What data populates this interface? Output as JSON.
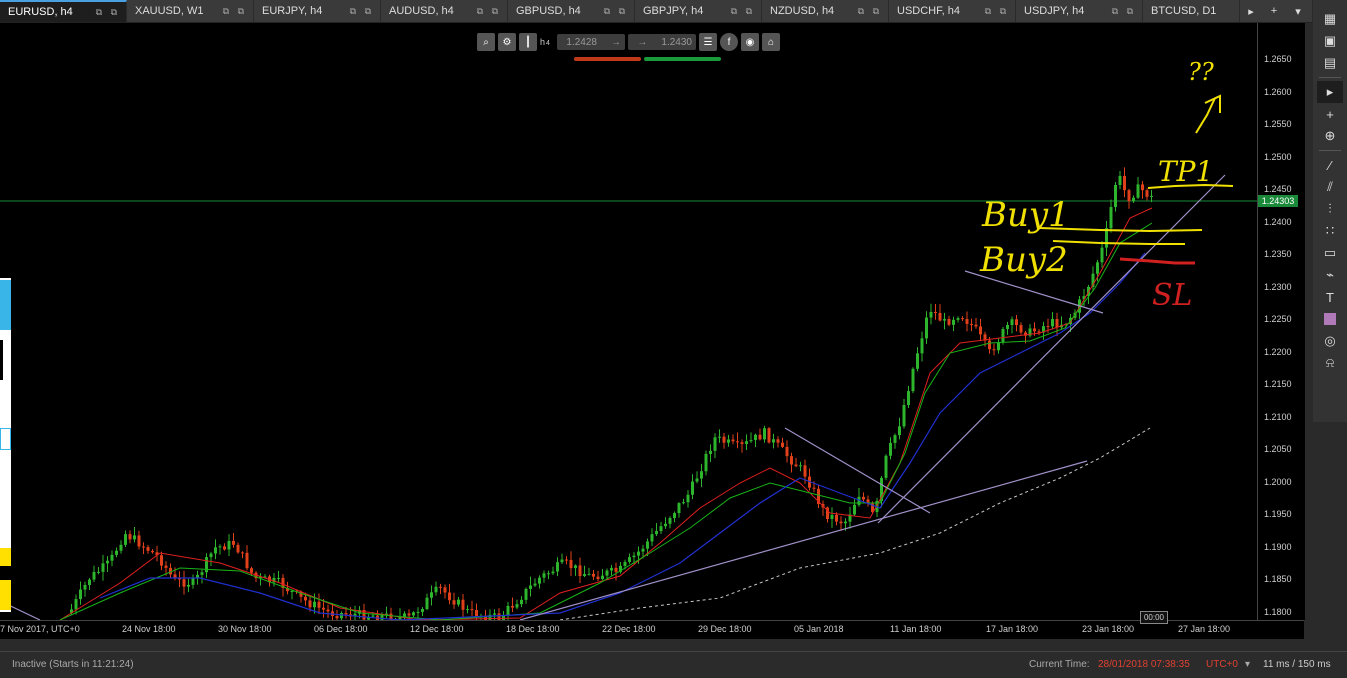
{
  "tabs": [
    {
      "label": "EURUSD, h4",
      "active": true
    },
    {
      "label": "XAUUSD, W1"
    },
    {
      "label": "EURJPY, h4"
    },
    {
      "label": "AUDUSD, h4"
    },
    {
      "label": "GBPUSD, h4"
    },
    {
      "label": "GBPJPY, h4"
    },
    {
      "label": "NZDUSD, h4"
    },
    {
      "label": "USDCHF, h4"
    },
    {
      "label": "USDJPY, h4"
    },
    {
      "label": "BTCUSD, D1"
    }
  ],
  "tab_nav": {
    "next": "▸",
    "add": "+",
    "overflow": "▾"
  },
  "trade_toolbar": {
    "timeframe": "h",
    "lot": "4",
    "sell_price": "1.2428",
    "buy_price": "1.2430"
  },
  "price_axis": {
    "ticks": [
      "1.2650",
      "1.2600",
      "1.2550",
      "1.2500",
      "1.2450",
      "1.2400",
      "1.2350",
      "1.2300",
      "1.2250",
      "1.2200",
      "1.2150",
      "1.2100",
      "1.2050",
      "1.2000",
      "1.1950",
      "1.1900",
      "1.1850",
      "1.1800"
    ],
    "current": "1.24303"
  },
  "time_axis": {
    "ticks": [
      "7 Nov 2017, UTC+0",
      "24 Nov 18:00",
      "30 Nov 18:00",
      "06 Dec 18:00",
      "12 Dec 18:00",
      "18 Dec 18:00",
      "22 Dec 18:00",
      "29 Dec 18:00",
      "05 Jan 2018",
      "11 Jan 18:00",
      "17 Jan 18:00",
      "23 Jan 18:00",
      "27 Jan 18:00"
    ],
    "cursor": "00:00"
  },
  "annotations": {
    "tp1": "TP1",
    "buy1": "Buy1",
    "buy2": "Buy2",
    "sl": "SL",
    "question": "??"
  },
  "status": {
    "state": "Inactive (Starts in 11:21:24)",
    "current_time_label": "Current Time:",
    "current_time": "28/01/2018 07:38:35",
    "tz": "UTC+0",
    "latency": "11 ms / 150 ms"
  },
  "colors": {
    "bull": "#2db52d",
    "bear": "#e0401a",
    "ema_fast": "#e02020",
    "ema_mid": "#18b418",
    "ema_slow": "#2030d0",
    "trend": "#a090c8",
    "annotation_yellow": "#f0e000",
    "annotation_red": "#d02020"
  }
}
